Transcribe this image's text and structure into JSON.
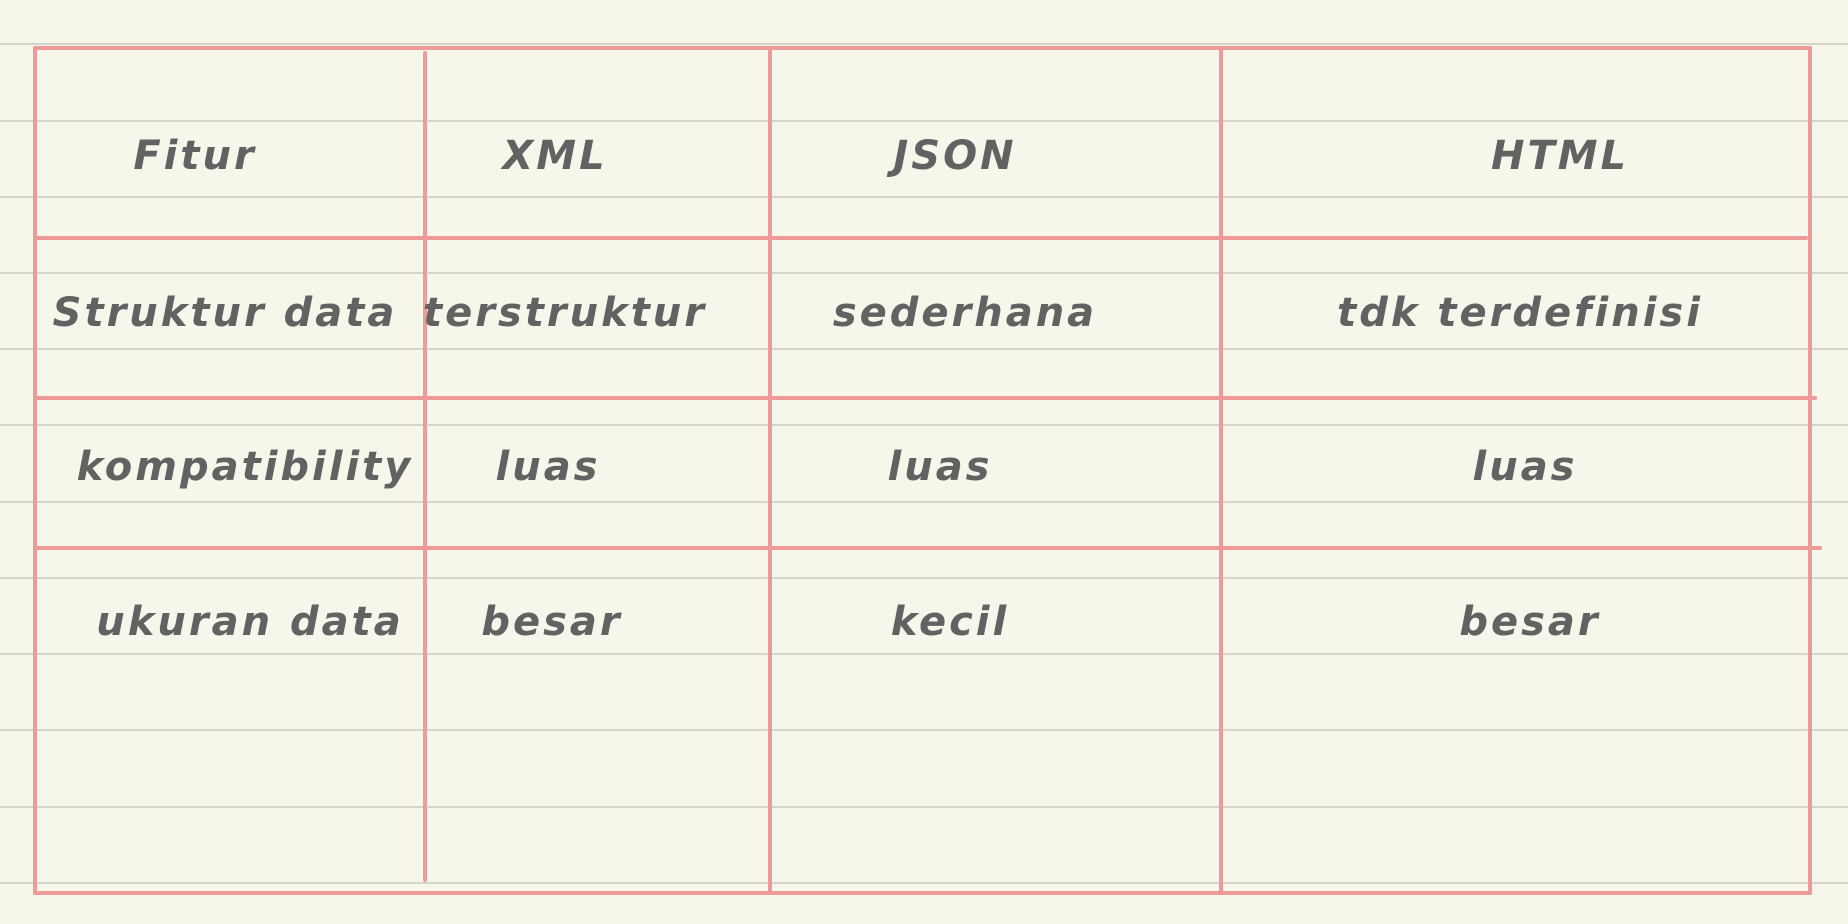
{
  "table": {
    "headers": [
      "Fitur",
      "XML",
      "JSON",
      "HTML"
    ],
    "rows": [
      [
        "Struktur data",
        "terstruktur",
        "sederhana",
        "tdk terdefinisi"
      ],
      [
        "kompatibility",
        "luas",
        "luas",
        "luas"
      ],
      [
        "ukuran data",
        "besar",
        "kecil",
        "besar"
      ]
    ]
  },
  "colors": {
    "paper": "#f7f6ea",
    "ruled_lines": "#d5d4cd",
    "table_lines": "#ee9a99",
    "handwriting": "#626262"
  }
}
